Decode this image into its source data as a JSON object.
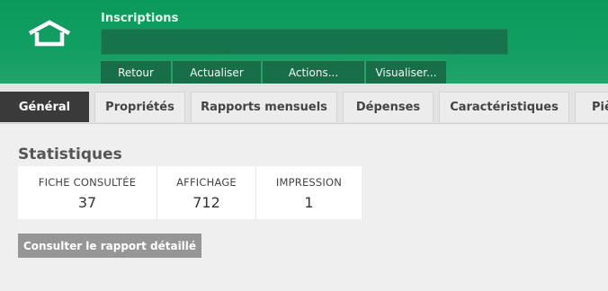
{
  "header": {
    "title": "Inscriptions",
    "home_icon": "home-icon",
    "search_value": "",
    "actions": [
      {
        "label": "Retour"
      },
      {
        "label": "Actualiser"
      },
      {
        "label": "Actions..."
      },
      {
        "label": "Visualiser..."
      }
    ]
  },
  "tabs": [
    {
      "label": "Général",
      "active": true
    },
    {
      "label": "Propriétés"
    },
    {
      "label": "Rapports mensuels"
    },
    {
      "label": "Dépenses"
    },
    {
      "label": "Caractéristiques"
    },
    {
      "label": "Piè"
    }
  ],
  "statistics": {
    "title": "Statistiques",
    "items": [
      {
        "label": "FICHE CONSULTÉE",
        "value": "37"
      },
      {
        "label": "AFFICHAGE",
        "value": "712"
      },
      {
        "label": "IMPRESSION",
        "value": "1"
      }
    ],
    "report_button": "Consulter le rapport détaillé"
  },
  "colors": {
    "header_green": "#0c9a5c",
    "action_green": "#186e48",
    "active_tab": "#3a3a3a",
    "button_gray": "#969696"
  }
}
